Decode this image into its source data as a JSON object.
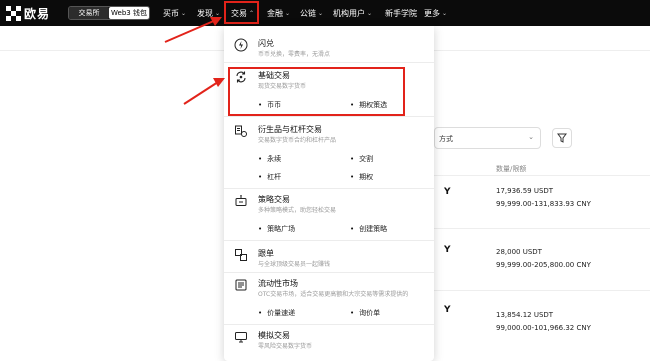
{
  "logo": {
    "text": "欧易"
  },
  "switch": {
    "exchange": "交易所",
    "web3": "Web3 钱包"
  },
  "nav": [
    "买币",
    "发现",
    "交易",
    "金融",
    "公链",
    "机构用户",
    "新手学院",
    "更多"
  ],
  "menu": {
    "items": [
      {
        "icon": "flash-icon",
        "title": "闪兑",
        "desc": "币币兑换，零费率，无滑点"
      },
      {
        "icon": "swap-icon",
        "title": "基础交易",
        "desc": "现货交易数字货币",
        "subs": [
          "币币",
          "期权策选"
        ]
      },
      {
        "icon": "derivatives-icon",
        "title": "衍生品与杠杆交易",
        "desc": "交易数字货币合约和杠杆产品",
        "subs": [
          "永续",
          "交割",
          "杠杆",
          "期权"
        ]
      },
      {
        "icon": "bot-icon",
        "title": "策略交易",
        "desc": "多种策略模式，助您轻松交易",
        "subs": [
          "策略广场",
          "创建策略"
        ]
      },
      {
        "icon": "copy-icon",
        "title": "跟单",
        "desc": "与全球顶级交易员一起赚钱"
      },
      {
        "icon": "liquidity-icon",
        "title": "流动性市场",
        "desc": "OTC交易市场，适合交易更高额和大宗交易等需求提供的",
        "subs": [
          "价量速递",
          "询价单"
        ]
      },
      {
        "icon": "demo-icon",
        "title": "模拟交易",
        "desc": "零风险交易数字货币"
      }
    ]
  },
  "background": {
    "select_label": "方式",
    "column_header": "数量/限额",
    "rows": [
      {
        "mark": "Y",
        "amount": "17,936.59 USDT",
        "limit": "99,999.00-131,833.93 CNY"
      },
      {
        "mark": "Y",
        "amount": "28,000 USDT",
        "limit": "99,999.00-205,800.00 CNY"
      },
      {
        "mark": "Y",
        "amount": "13,854.12 USDT",
        "limit": "99,000.00-101,966.32 CNY"
      }
    ]
  },
  "colors": {
    "topbar": "#0b0b0b",
    "highlight": "#e2231a"
  }
}
